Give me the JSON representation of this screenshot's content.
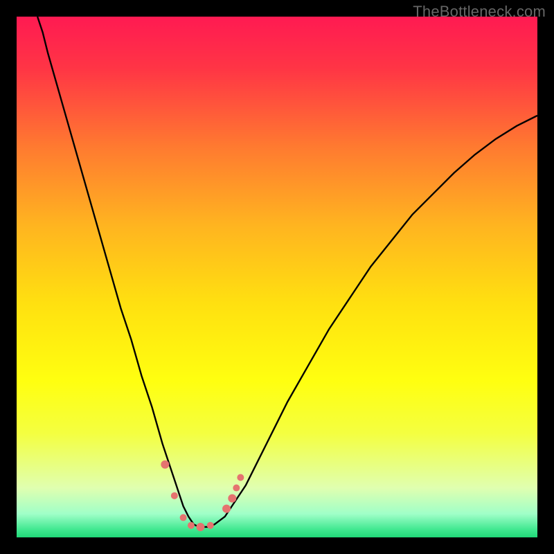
{
  "watermark": "TheBottleneck.com",
  "gradient_stops": [
    {
      "offset": 0.0,
      "color": "#ff1a52"
    },
    {
      "offset": 0.1,
      "color": "#ff3545"
    },
    {
      "offset": 0.25,
      "color": "#ff7a30"
    },
    {
      "offset": 0.4,
      "color": "#ffb420"
    },
    {
      "offset": 0.55,
      "color": "#ffe010"
    },
    {
      "offset": 0.7,
      "color": "#ffff10"
    },
    {
      "offset": 0.8,
      "color": "#f4ff40"
    },
    {
      "offset": 0.86,
      "color": "#e8ff80"
    },
    {
      "offset": 0.905,
      "color": "#e0ffb0"
    },
    {
      "offset": 0.955,
      "color": "#a0ffc8"
    },
    {
      "offset": 0.985,
      "color": "#40e890"
    },
    {
      "offset": 1.0,
      "color": "#20d878"
    }
  ],
  "chart_data": {
    "type": "line",
    "title": "",
    "xlabel": "",
    "ylabel": "",
    "xlim": [
      0,
      100
    ],
    "ylim": [
      0,
      100
    ],
    "series": [
      {
        "name": "curve",
        "x": [
          4,
          5,
          6,
          8,
          10,
          12,
          14,
          16,
          18,
          20,
          22,
          24,
          26,
          28,
          29,
          30,
          31,
          32,
          33,
          34,
          35,
          36,
          37,
          38,
          40,
          42,
          44,
          46,
          48,
          50,
          52,
          56,
          60,
          64,
          68,
          72,
          76,
          80,
          84,
          88,
          92,
          96,
          100
        ],
        "y": [
          100,
          97,
          93,
          86,
          79,
          72,
          65,
          58,
          51,
          44,
          38,
          31,
          25,
          18,
          15,
          12,
          9,
          6,
          4,
          2.5,
          2,
          2,
          2,
          2.5,
          4,
          7,
          10,
          14,
          18,
          22,
          26,
          33,
          40,
          46,
          52,
          57,
          62,
          66,
          70,
          73.5,
          76.5,
          79,
          81
        ]
      }
    ],
    "markers": [
      {
        "x": 28.5,
        "y": 14,
        "r": 6
      },
      {
        "x": 30.3,
        "y": 8,
        "r": 5
      },
      {
        "x": 32.0,
        "y": 3.8,
        "r": 5
      },
      {
        "x": 33.5,
        "y": 2.3,
        "r": 5
      },
      {
        "x": 35.3,
        "y": 2,
        "r": 6
      },
      {
        "x": 37.2,
        "y": 2.3,
        "r": 5
      },
      {
        "x": 40.3,
        "y": 5.5,
        "r": 6
      },
      {
        "x": 41.4,
        "y": 7.5,
        "r": 6
      },
      {
        "x": 42.2,
        "y": 9.5,
        "r": 5
      },
      {
        "x": 43.0,
        "y": 11.5,
        "r": 5
      }
    ],
    "marker_color": "#e5736f",
    "curve_color": "#000000"
  }
}
